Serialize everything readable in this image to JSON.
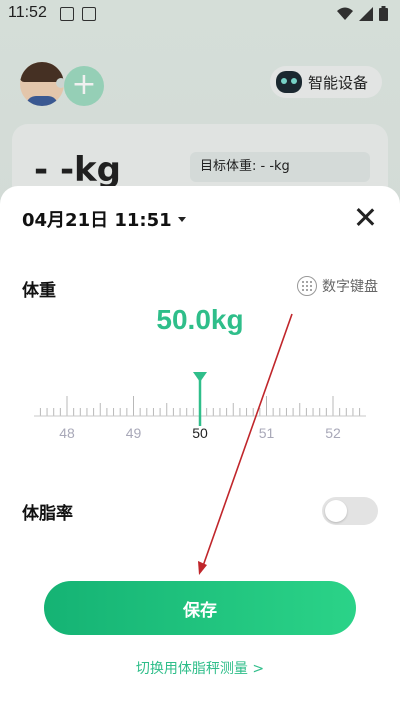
{
  "status_bar": {
    "time": "11:52"
  },
  "background": {
    "device_button_label": "智能设备",
    "weight_display": "- -kg",
    "target_weight": "目标体重: - -kg"
  },
  "sheet": {
    "date": "04月21日 11:51",
    "weight_label": "体重",
    "keypad_label": "数字键盘",
    "weight_value": "50.0kg",
    "ruler_ticks": [
      "48",
      "49",
      "50",
      "51",
      "52"
    ],
    "selected_tick": "50",
    "body_fat_label": "体脂率",
    "body_fat_enabled": false,
    "save_label": "保存",
    "switch_label": "切换用体脂秤测量 >"
  },
  "colors": {
    "accent": "#2fbe8a",
    "annotation_arrow": "#c0262b"
  }
}
